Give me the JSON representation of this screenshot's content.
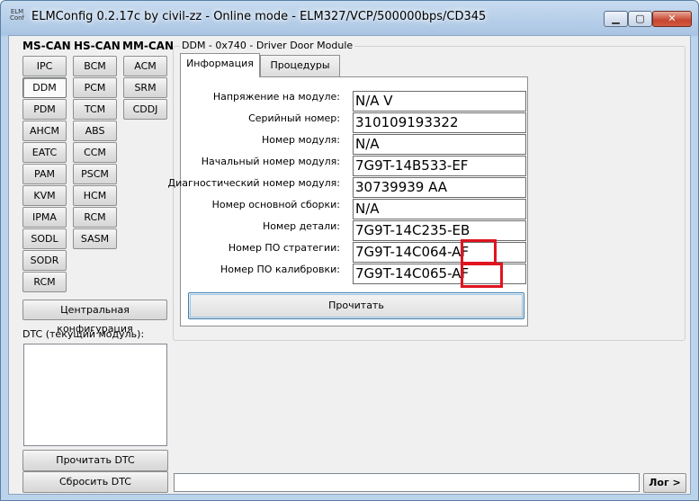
{
  "window": {
    "title": "ELMConfig 0.2.17c by civil-zz - Online mode - ELM327/VCP/500000bps/CD345",
    "icon_text": [
      "ELM",
      "Conf"
    ],
    "minimize_glyph": "▁",
    "maximize_glyph": "▢",
    "close_glyph": "✕"
  },
  "modules": {
    "ms_can_label": "MS-CAN",
    "hs_can_label": "HS-CAN",
    "mm_can_label": "MM-CAN",
    "ms_can": [
      "IPC",
      "DDM",
      "PDM",
      "AHCM",
      "EATC",
      "PAM",
      "KVM",
      "IPMA",
      "SODL",
      "SODR",
      "RCM"
    ],
    "hs_can": [
      "BCM",
      "PCM",
      "TCM",
      "ABS",
      "CCM",
      "PSCM",
      "HCM",
      "RCM",
      "SASM"
    ],
    "mm_can": [
      "ACM",
      "SRM",
      "CDDJ"
    ],
    "selected": "DDM"
  },
  "central_config_label": "Центральная конфигурация",
  "dtc_label": "DTC (текущий модуль):",
  "read_dtc_label": "Прочитать DTC",
  "reset_dtc_label": "Сбросить DTC",
  "group_title": "DDM - 0x740 - Driver Door Module",
  "tabs": [
    "Информация",
    "Процедуры"
  ],
  "fields": [
    {
      "label": "Напряжение на модуле:",
      "value": "N/A V"
    },
    {
      "label": "Серийный номер:",
      "value": "310109193322"
    },
    {
      "label": "Номер модуля:",
      "value": "N/A"
    },
    {
      "label": "Начальный номер модуля:",
      "value": "7G9T-14B533-EF"
    },
    {
      "label": "Диагностический номер модуля:",
      "value": "30739939 AA"
    },
    {
      "label": "Номер основной сборки:",
      "value": "N/A"
    },
    {
      "label": "Номер детали:",
      "value": "7G9T-14C235-EB"
    },
    {
      "label": "Номер ПО стратегии:",
      "value": "7G9T-14C064-AF"
    },
    {
      "label": "Номер ПО калибровки:",
      "value": "7G9T-14C065-AF"
    }
  ],
  "read_button_label": "Прочитать",
  "log_button_label": "Лог >",
  "highlight_color": "#e0141e"
}
